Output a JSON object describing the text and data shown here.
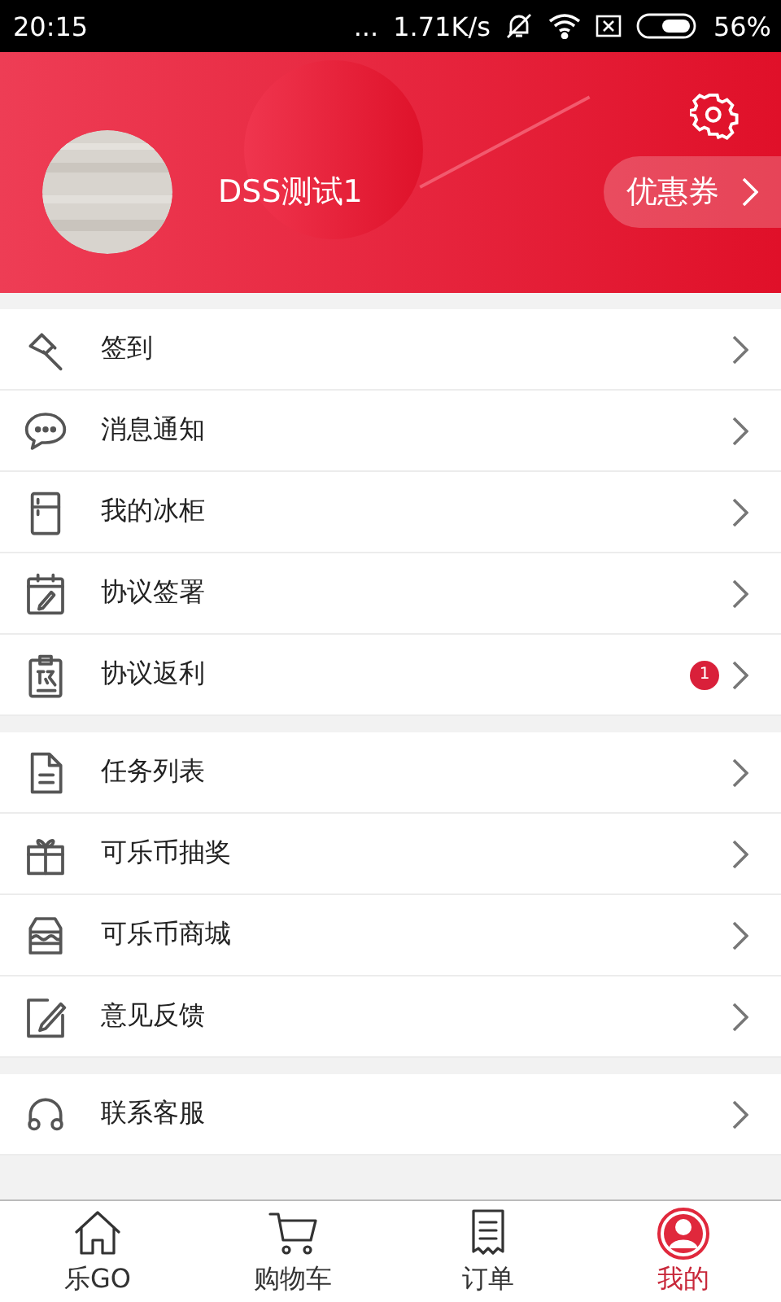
{
  "status_bar": {
    "time": "20:15",
    "dots": "...",
    "speed": "1.71K/s",
    "battery": "56%"
  },
  "profile": {
    "name": "DSS测试1",
    "coupon": "优惠券"
  },
  "menu_groups": [
    [
      {
        "label": "签到"
      },
      {
        "label": "消息通知"
      },
      {
        "label": "我的冰柜"
      },
      {
        "label": "协议签署"
      },
      {
        "label": "协议返利",
        "badge": "1"
      }
    ],
    [
      {
        "label": "任务列表"
      },
      {
        "label": "可乐币抽奖"
      },
      {
        "label": "可乐币商城"
      },
      {
        "label": "意见反馈"
      }
    ],
    [
      {
        "label": "联系客服"
      }
    ]
  ],
  "tabs": [
    {
      "label": "乐GO",
      "selected": false
    },
    {
      "label": "购物车",
      "selected": false
    },
    {
      "label": "订单",
      "selected": false
    },
    {
      "label": "我的",
      "selected": true
    }
  ]
}
